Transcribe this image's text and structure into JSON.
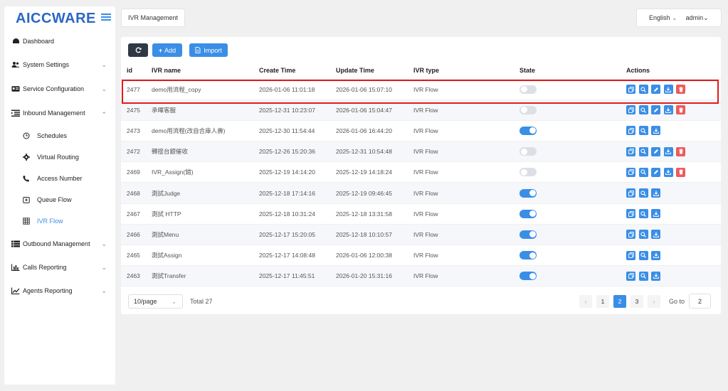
{
  "sidebar": {
    "logo_part1": "AICC",
    "logo_part2": "WARE",
    "items": [
      {
        "label": "Dashboard",
        "icon": "dashboard-icon"
      },
      {
        "label": "System Settings",
        "icon": "users-icon"
      },
      {
        "label": "Service Configuration",
        "icon": "id-card-icon"
      },
      {
        "label": "Inbound Management",
        "icon": "list-indent-icon"
      },
      {
        "label": "Outbound Management",
        "icon": "list-icon"
      },
      {
        "label": "Calls Reporting",
        "icon": "bar-chart-icon"
      },
      {
        "label": "Agents Reporting",
        "icon": "line-chart-icon"
      }
    ],
    "sub_items": [
      {
        "label": "Schedules",
        "icon": "clock-icon"
      },
      {
        "label": "Virtual Routing",
        "icon": "gear-icon"
      },
      {
        "label": "Access Number",
        "icon": "phone-icon"
      },
      {
        "label": "Queue Flow",
        "icon": "inbox-icon"
      },
      {
        "label": "IVR Flow",
        "icon": "grid-icon"
      }
    ]
  },
  "header": {
    "tab": "IVR Management",
    "language": "English",
    "user": "admin"
  },
  "toolbar": {
    "add_label": "Add",
    "import_label": "Import"
  },
  "table": {
    "columns": [
      "id",
      "IVR name",
      "Create Time",
      "Update Time",
      "IVR type",
      "State",
      "Actions"
    ],
    "rows": [
      {
        "id": "2477",
        "name": "demo用流程_copy",
        "create": "2026-01-06 11:01:18",
        "update": "2026-01-06 15:07:10",
        "type": "IVR Flow",
        "state": false
      },
      {
        "id": "2475",
        "name": "承暉客服",
        "create": "2025-12-31 10:23:07",
        "update": "2026-01-06 15:04:47",
        "type": "IVR Flow",
        "state": false
      },
      {
        "id": "2473",
        "name": "demo用流程(改自合庫人壽)",
        "create": "2025-12-30 11:54:44",
        "update": "2026-01-06 16:44:20",
        "type": "IVR Flow",
        "state": true
      },
      {
        "id": "2472",
        "name": "轉接台銀催收",
        "create": "2025-12-26 15:20:36",
        "update": "2025-12-31 10:54:48",
        "type": "IVR Flow",
        "state": false
      },
      {
        "id": "2469",
        "name": "IVR_Assign(錯)",
        "create": "2025-12-19 14:14:20",
        "update": "2025-12-19 14:18:24",
        "type": "IVR Flow",
        "state": false
      },
      {
        "id": "2468",
        "name": "測試Judge",
        "create": "2025-12-18 17:14:16",
        "update": "2025-12-19 09:46:45",
        "type": "IVR Flow",
        "state": true
      },
      {
        "id": "2467",
        "name": "測試 HTTP",
        "create": "2025-12-18 10:31:24",
        "update": "2025-12-18 13:31:58",
        "type": "IVR Flow",
        "state": true
      },
      {
        "id": "2466",
        "name": "測試Menu",
        "create": "2025-12-17 15:20:05",
        "update": "2025-12-18 10:10:57",
        "type": "IVR Flow",
        "state": true
      },
      {
        "id": "2465",
        "name": "測試Assign",
        "create": "2025-12-17 14:08:48",
        "update": "2026-01-06 12:00:38",
        "type": "IVR Flow",
        "state": true
      },
      {
        "id": "2463",
        "name": "測試Transfer",
        "create": "2025-12-17 11:45:51",
        "update": "2026-01-20 15:31:16",
        "type": "IVR Flow",
        "state": true
      }
    ]
  },
  "pagination": {
    "page_size": "10/page",
    "total": "Total 27",
    "pages": [
      "1",
      "2",
      "3"
    ],
    "current_page": "2",
    "goto_label": "Go to",
    "goto_value": "2"
  },
  "colors": {
    "accent": "#3a8ee6",
    "danger": "#ef5b5b",
    "highlight": "#e31a1a"
  }
}
